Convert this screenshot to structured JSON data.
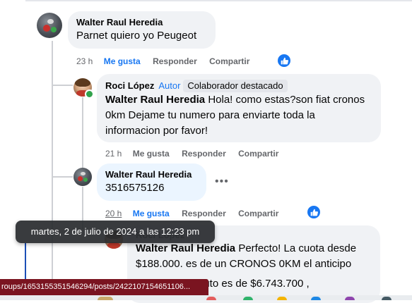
{
  "comments": [
    {
      "author": "Walter Raul Heredia",
      "text": "Parnet quiero yo Peugeot",
      "time": "23 h",
      "like_label": "Me gusta",
      "reply_label": "Responder",
      "share_label": "Compartir",
      "liked": true
    },
    {
      "author": "Roci López",
      "author_badge": "Autor",
      "author_tag": "Colaborador destacado",
      "mention": "Walter Raul Heredia",
      "text": " Hola! como estas?son fiat cronos 0km Dejame tu numero para enviarte toda la informacion por favor!",
      "time": "21 h",
      "like_label": "Me gusta",
      "reply_label": "Responder",
      "share_label": "Compartir"
    },
    {
      "author": "Walter Raul Heredia",
      "text": "3516575126",
      "time": "20 h",
      "like_label": "Me gusta",
      "reply_label": "Responder",
      "share_label": "Compartir",
      "liked": true
    },
    {
      "author": "Roci López",
      "mention": "Walter Raul Heredia",
      "text": " Perfecto! La cuota desde $188.000. es de un CRONOS 0KM el anticipo",
      "text_line3_tail": "auto es de $6.743.700 ,"
    }
  ],
  "tooltip": "martes, 2 de julio de 2024 a las 12:23 pm",
  "status_url": "roups/1653155351546294/posts/2422107154651106...",
  "colors": {
    "accent": "#1877f2",
    "bubble": "#f0f2f5",
    "status_bar": "#7a1420",
    "online": "#31a24c"
  },
  "icons": [
    "thumbs-up-icon",
    "more-icon",
    "online-dot"
  ]
}
